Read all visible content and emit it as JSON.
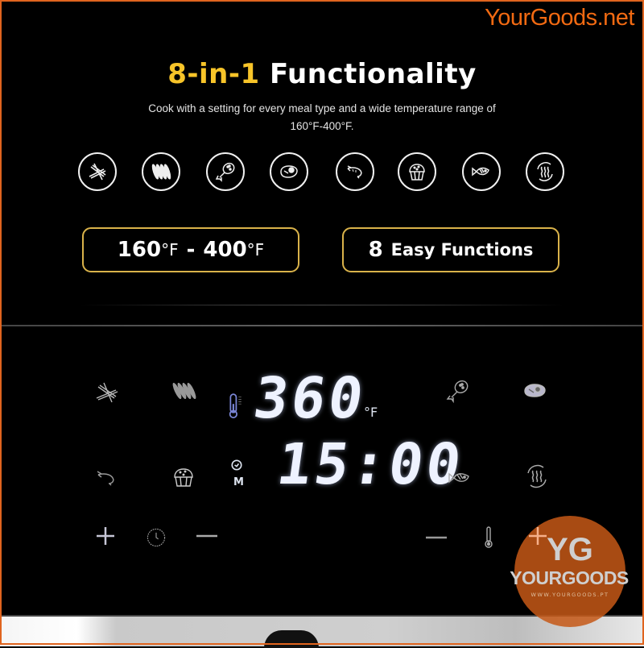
{
  "watermark_top": "YourGoods.net",
  "heading": {
    "accent": "8-in-1",
    "rest": "Functionality"
  },
  "subtitle": {
    "line1": "Cook with a setting for every meal type and a wide temperature range of",
    "line2": "160°F-400°F."
  },
  "function_icons": [
    {
      "name": "fries-icon"
    },
    {
      "name": "sausage-icon"
    },
    {
      "name": "chicken-leg-icon"
    },
    {
      "name": "steak-icon"
    },
    {
      "name": "shrimp-icon"
    },
    {
      "name": "muffin-icon"
    },
    {
      "name": "fish-icon"
    },
    {
      "name": "dehydrate-icon"
    }
  ],
  "badges": {
    "range": {
      "low": "160",
      "high": "400",
      "unit": "°F",
      "separator": "-"
    },
    "functions": {
      "count": "8",
      "label": "Easy Functions"
    }
  },
  "display": {
    "temperature": "360",
    "temperature_unit": "°F",
    "time": "15:00",
    "mode_label": "M"
  },
  "controls": {
    "time_plus": "+",
    "time_minus": "−",
    "temp_minus": "−",
    "temp_plus": "+"
  },
  "watermark_badge": {
    "initials": "YG",
    "name": "YOURGOODS",
    "url": "WWW.YOURGOODS.PT"
  },
  "colors": {
    "accent_yellow": "#f7c429",
    "badge_border": "#d9b24a",
    "brand_orange": "#f26a12"
  }
}
